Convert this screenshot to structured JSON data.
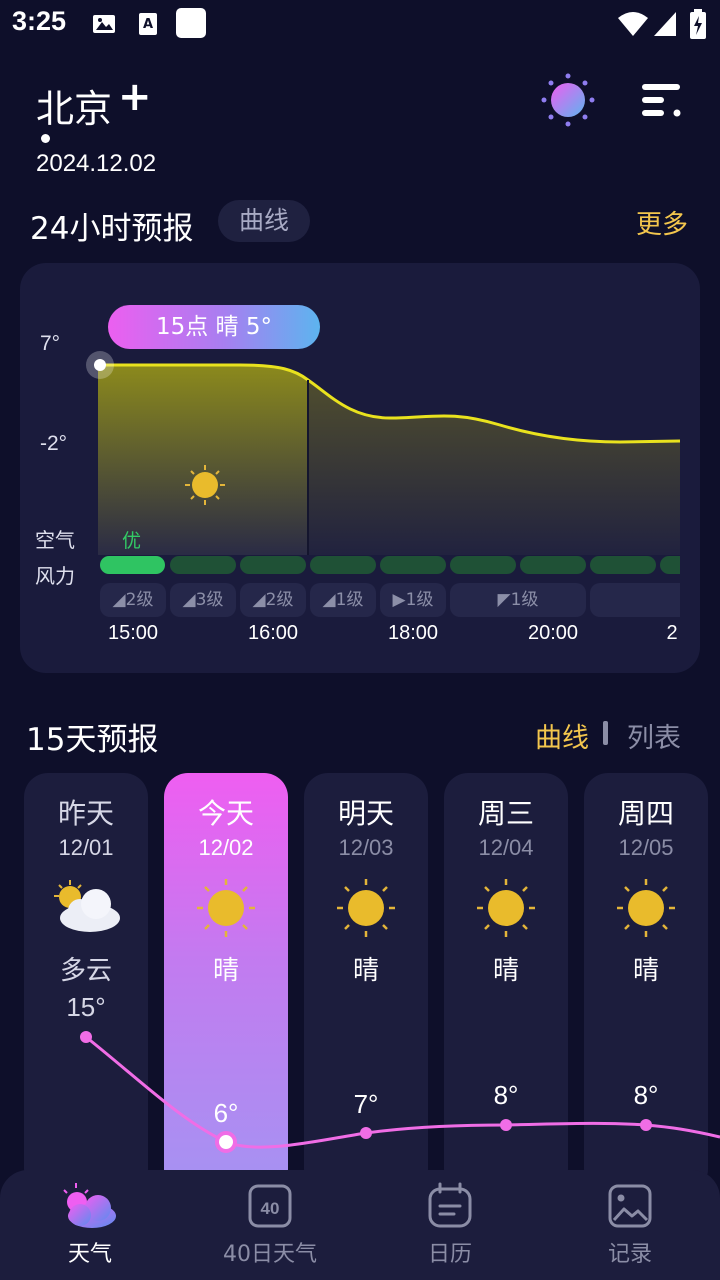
{
  "status_bar": {
    "time": "3:25"
  },
  "header": {
    "city": "北京",
    "add": "+",
    "date": "2024.12.02"
  },
  "hourly": {
    "title": "24小时预报",
    "mode_chip": "曲线",
    "more": "更多",
    "tooltip": "15点 晴 5°",
    "y_max": "7°",
    "y_min": "-2°",
    "air_label": "空气",
    "wind_label": "风力",
    "aqi_first": "优",
    "winds": [
      "2级",
      "3级",
      "2级",
      "1级",
      "1级",
      "1级"
    ],
    "hours": [
      "15:00",
      "16:00",
      "18:00",
      "20:00",
      "2"
    ]
  },
  "daily": {
    "title": "15天预报",
    "tab_curve": "曲线",
    "tab_list": "列表",
    "days": [
      {
        "name": "昨天",
        "date": "12/01",
        "cond": "多云",
        "high": "15°",
        "icon": "partly-cloudy-icon"
      },
      {
        "name": "今天",
        "date": "12/02",
        "cond": "晴",
        "high": "6°",
        "icon": "sun-icon"
      },
      {
        "name": "明天",
        "date": "12/03",
        "cond": "晴",
        "high": "7°",
        "icon": "sun-icon"
      },
      {
        "name": "周三",
        "date": "12/04",
        "cond": "晴",
        "high": "8°",
        "icon": "sun-icon"
      },
      {
        "name": "周四",
        "date": "12/05",
        "cond": "晴",
        "high": "8°",
        "icon": "sun-icon"
      }
    ]
  },
  "nav": {
    "items": [
      {
        "label": "天气",
        "icon": "weather-icon",
        "active": true
      },
      {
        "label": "40日天气",
        "icon": "forty-day-icon",
        "active": false
      },
      {
        "label": "日历",
        "icon": "calendar-icon",
        "active": false
      },
      {
        "label": "记录",
        "icon": "gallery-icon",
        "active": false
      }
    ]
  },
  "colors": {
    "accent_yellow": "#f3c64d",
    "accent_pink": "#ef5ef1",
    "aqi_good": "#33cc66",
    "curve": "#e9e21e"
  }
}
